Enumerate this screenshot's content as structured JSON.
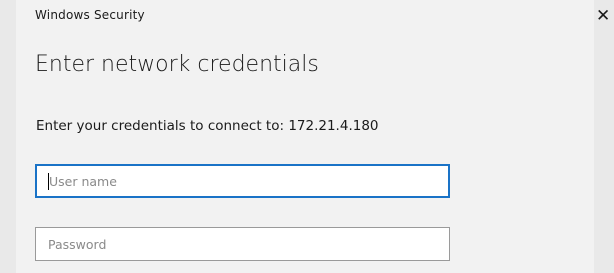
{
  "window": {
    "title": "Windows Security",
    "close_glyph": "✕"
  },
  "dialog": {
    "heading": "Enter network credentials",
    "prompt": "Enter your credentials to connect to: 172.21.4.180"
  },
  "fields": {
    "username": {
      "value": "",
      "placeholder": "User name"
    },
    "password": {
      "value": "",
      "placeholder": "Password"
    }
  },
  "colors": {
    "accent": "#1a73c7",
    "background": "#f2f2f2",
    "outer_background": "#e9e9e9"
  }
}
